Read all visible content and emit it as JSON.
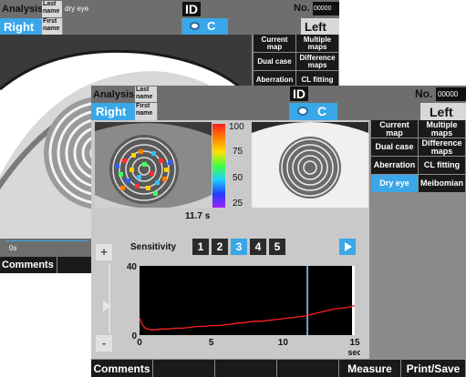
{
  "back": {
    "analysis": "Analysis",
    "last_name_label": "Last name",
    "last_name_value": "dry eye",
    "first_name_label": "First name",
    "id_label": "ID",
    "no_label": "No.",
    "no_value": "00000",
    "eye_right": "Right",
    "eye_left": "Left",
    "camera_letter": "C",
    "menu": [
      "Current map",
      "Multiple maps",
      "Dual case",
      "Difference maps",
      "Aberration",
      "CL fitting"
    ],
    "time": "0s",
    "comments": "Comments"
  },
  "front": {
    "analysis": "Analysis",
    "last_name_label": "Last name",
    "first_name_label": "First name",
    "id_label": "ID",
    "no_label": "No.",
    "no_value": "00000",
    "eye_right": "Right",
    "eye_left": "Left",
    "camera_letter": "C",
    "menu": [
      "Current map",
      "Multiple maps",
      "Dual case",
      "Difference maps",
      "Aberration",
      "CL fitting",
      "Dry eye",
      "Meibomian"
    ],
    "selected_menu": "Dry eye",
    "scale_labels": [
      "100",
      "75",
      "50",
      "25"
    ],
    "elapsed": "11.7 s",
    "sensitivity_label": "Sensitivity",
    "sensitivity_levels": [
      "1",
      "2",
      "3",
      "4",
      "5"
    ],
    "sensitivity_selected": "3",
    "zoom_plus": "+",
    "zoom_minus": "-",
    "bottom": [
      "Comments",
      "",
      "",
      "",
      "Measure",
      "Print/Save"
    ]
  },
  "chart_data": {
    "type": "line",
    "ylim": [
      0,
      40
    ],
    "xlim": [
      0,
      15
    ],
    "y_ticks": [
      "40",
      "0"
    ],
    "x_ticks": [
      "0",
      "5",
      "10",
      "15"
    ],
    "xlabel": "sec",
    "marker_x": 11.7,
    "colors": {
      "series": "#ff2020",
      "marker": "#7a9bd8",
      "background": "#000000"
    },
    "series": [
      {
        "x": [
          0,
          0.2,
          0.4,
          0.6,
          0.8,
          1,
          1.5,
          2,
          2.5,
          3,
          3.5,
          4,
          4.5,
          5,
          5.5,
          6,
          6.5,
          7,
          7.5,
          8,
          8.5,
          9,
          9.5,
          10,
          10.5,
          11,
          11.5,
          12,
          12.5,
          13,
          13.5,
          14,
          14.5,
          15
        ],
        "values": [
          10,
          6,
          4,
          3.5,
          3,
          3,
          3.5,
          3.5,
          4,
          4,
          4.5,
          5,
          5,
          5.5,
          5.5,
          6,
          6.5,
          7,
          7.5,
          8,
          8,
          8.5,
          9,
          9.5,
          10,
          10.5,
          11,
          12,
          13,
          14,
          15,
          15.5,
          16,
          17
        ]
      }
    ]
  },
  "colors": {
    "accent": "#3aa7e8",
    "bar": "#6b6b6b",
    "dark": "#1a1a1a"
  }
}
